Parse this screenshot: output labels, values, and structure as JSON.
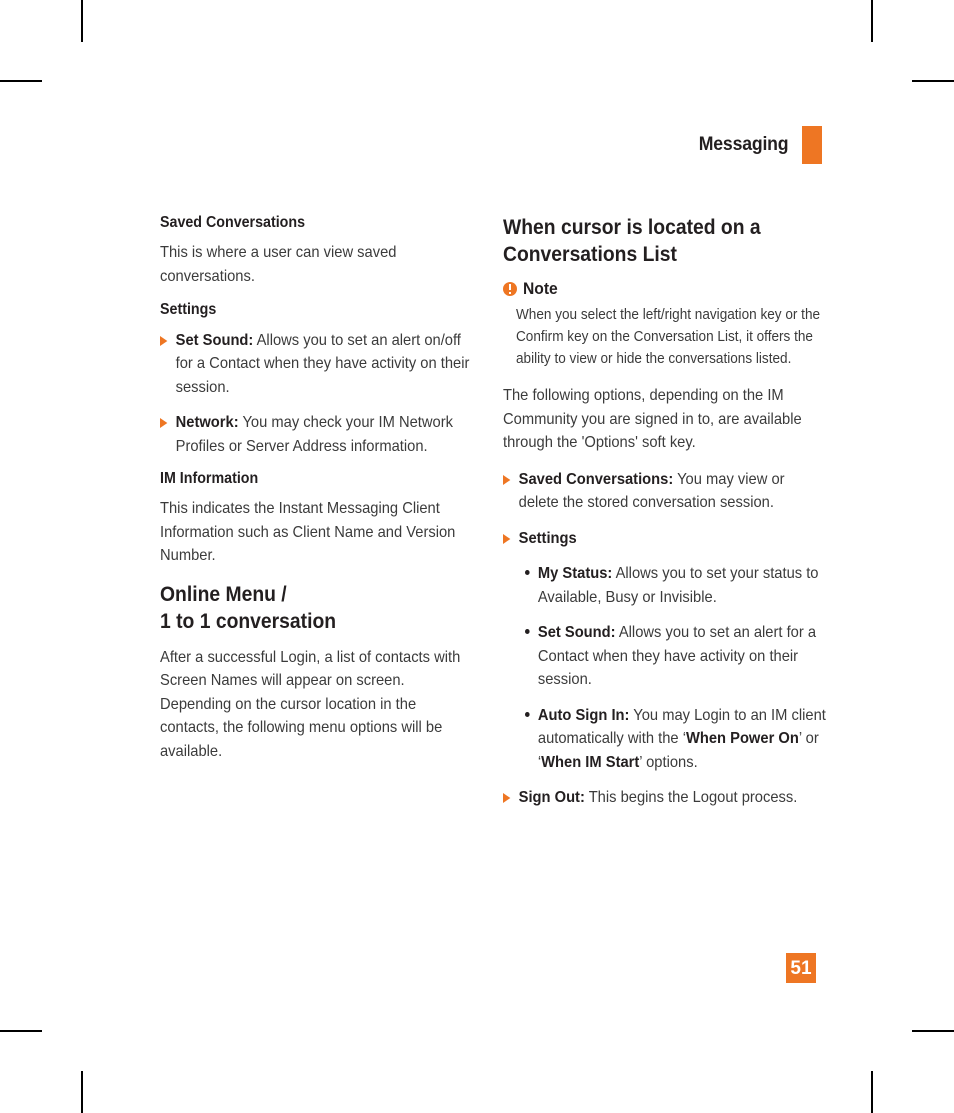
{
  "header": {
    "title": "Messaging",
    "accent_color": "#ee7623"
  },
  "page_number": "51",
  "left_column": {
    "saved_conversations_heading": "Saved Conversations",
    "saved_conversations_body": "This is where a user can view saved conversations.",
    "settings_heading": "Settings",
    "settings_items": [
      {
        "lead": "Set Sound:",
        "text": " Allows you to set an alert on/off for a Contact when they have activity on their session."
      },
      {
        "lead": "Network:",
        "text": " You may check your IM Network Profiles or Server Address information."
      }
    ],
    "im_information_heading": "IM Information",
    "im_information_body": "This indicates the Instant Messaging Client Information such as Client Name and Version Number.",
    "online_menu_heading_line1": "Online Menu /",
    "online_menu_heading_line2": "1 to 1 conversation",
    "online_menu_body": "After a successful Login, a list of contacts with Screen Names will appear on screen. Depending on the cursor location in the contacts, the following menu options will be available."
  },
  "right_column": {
    "heading_line1": "When cursor is located on a",
    "heading_line2": "Conversations List",
    "note": {
      "icon": "exclamation-circle-icon",
      "title": "Note",
      "body": "When you select the left/right navigation key or the Confirm key on the Conversation List, it offers the ability to view or hide the conversations listed."
    },
    "intro_body": "The following options, depending on the IM Community you are signed in to, are available through the 'Options' soft key.",
    "options": [
      {
        "lead": "Saved Conversations:",
        "text": " You may view or delete the stored conversation session."
      },
      {
        "lead": "Settings",
        "text": ""
      },
      {
        "lead": "Sign Out:",
        "text": " This begins the Logout process."
      }
    ],
    "settings_sub_items": [
      {
        "lead": "My Status:",
        "text": " Allows you to set your status to Available, Busy or Invisible."
      },
      {
        "lead": "Set Sound:",
        "text": " Allows you to set an alert for a Contact when they have activity on their session."
      },
      {
        "lead": "Auto Sign In:",
        "text_part1": " You may Login to an IM client automatically with the ‘",
        "emph1": "When Power On",
        "text_part2": "’ or ‘",
        "emph2": "When IM Start",
        "text_part3": "’ options."
      }
    ]
  }
}
